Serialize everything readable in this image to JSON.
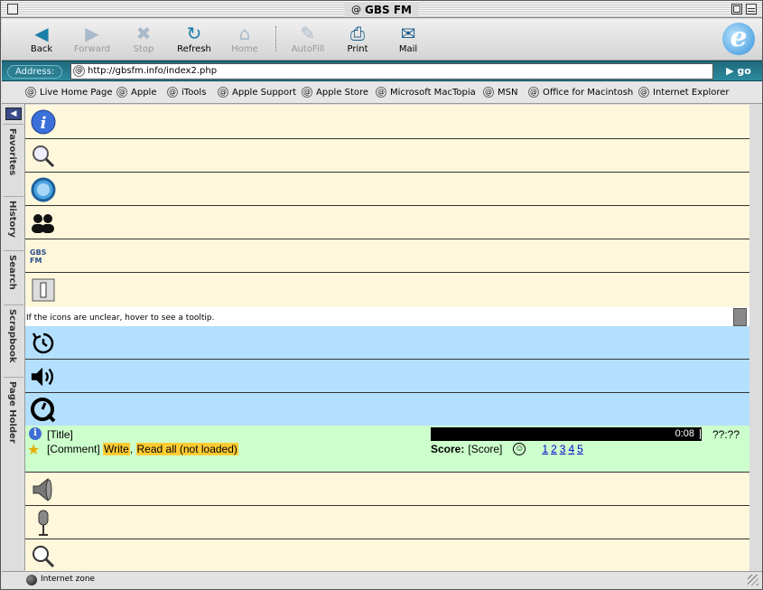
{
  "window": {
    "title": "GBS FM"
  },
  "toolbar": {
    "back": "Back",
    "forward": "Forward",
    "stop": "Stop",
    "refresh": "Refresh",
    "home": "Home",
    "autofill": "AutoFill",
    "print": "Print",
    "mail": "Mail"
  },
  "address": {
    "label": "Address:",
    "url": "http://gbsfm.info/index2.php",
    "go": "go"
  },
  "favorites": [
    "Live Home Page",
    "Apple",
    "iTools",
    "Apple Support",
    "Apple Store",
    "Microsoft MacTopia",
    "MSN",
    "Office for Macintosh",
    "Internet Explorer"
  ],
  "sidetabs": [
    "Favorites",
    "History",
    "Search",
    "Scrapbook",
    "Page Holder"
  ],
  "content": {
    "logo_text": "GBS FM",
    "hint": "If the icons are unclear, hover to see a tooltip."
  },
  "player": {
    "title": "[Title]",
    "comment": "[Comment]",
    "write": "Write",
    "separator": ",",
    "read_all": "Read all (not loaded)",
    "elapsed": "0:08",
    "total": "??:??",
    "score_label": "Score:",
    "score_value": "[Score]",
    "ratings": [
      "1",
      "2",
      "3",
      "4",
      "5"
    ],
    "progress_fraction": 0.0
  },
  "status": {
    "zone": "Internet zone"
  }
}
